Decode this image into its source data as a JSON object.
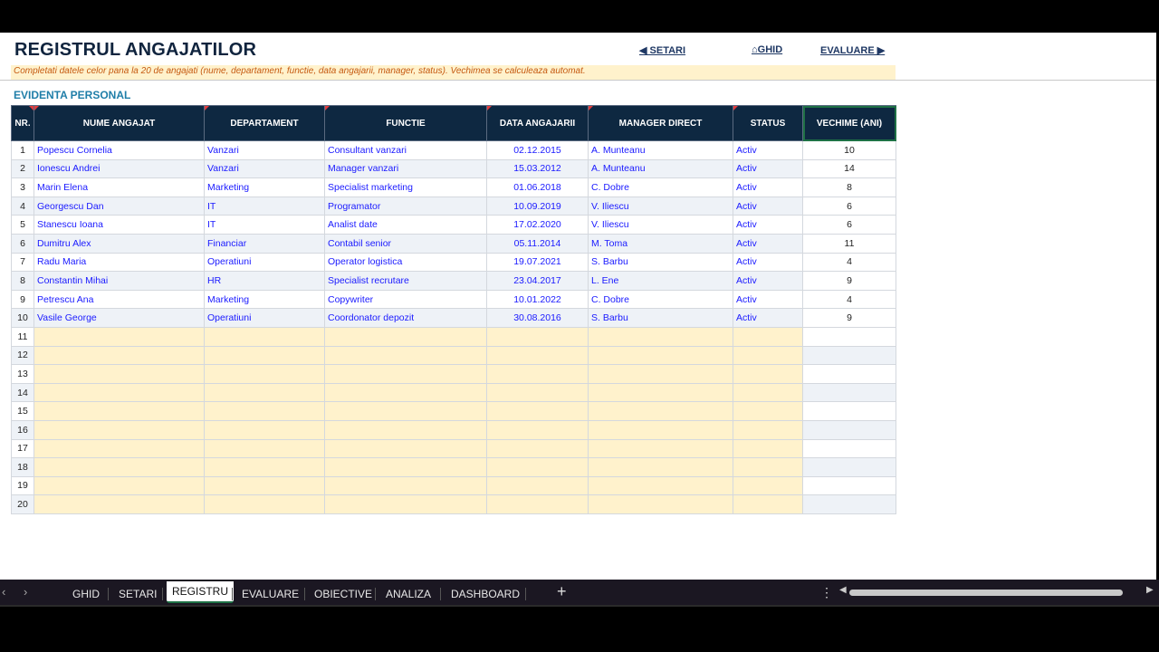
{
  "title": "REGISTRUL ANGAJATILOR",
  "nav": {
    "setari": "◀ SETARI",
    "ghid": "⌂GHID",
    "evaluare": "EVALUARE ▶"
  },
  "subtitle": "Completati datele celor pana la 20 de angajati (nume, departament, functie, data angajarii, manager, status). Vechimea se calculeaza automat.",
  "section_title": "EVIDENTA PERSONAL",
  "columns": [
    "NR.",
    "NUME ANGAJAT",
    "DEPARTAMENT",
    "FUNCTIE",
    "DATA ANGAJARII",
    "MANAGER DIRECT",
    "STATUS",
    "VECHIME (ANI)"
  ],
  "rows": [
    {
      "nr": "1",
      "nume": "Popescu Cornelia",
      "dep": "Vanzari",
      "functie": "Consultant vanzari",
      "data": "02.12.2015",
      "manager": "A. Munteanu",
      "status": "Activ",
      "vechime": "10"
    },
    {
      "nr": "2",
      "nume": "Ionescu Andrei",
      "dep": "Vanzari",
      "functie": "Manager vanzari",
      "data": "15.03.2012",
      "manager": "A. Munteanu",
      "status": "Activ",
      "vechime": "14"
    },
    {
      "nr": "3",
      "nume": "Marin Elena",
      "dep": "Marketing",
      "functie": "Specialist marketing",
      "data": "01.06.2018",
      "manager": "C. Dobre",
      "status": "Activ",
      "vechime": "8"
    },
    {
      "nr": "4",
      "nume": "Georgescu Dan",
      "dep": "IT",
      "functie": "Programator",
      "data": "10.09.2019",
      "manager": "V. Iliescu",
      "status": "Activ",
      "vechime": "6"
    },
    {
      "nr": "5",
      "nume": "Stanescu Ioana",
      "dep": "IT",
      "functie": "Analist date",
      "data": "17.02.2020",
      "manager": "V. Iliescu",
      "status": "Activ",
      "vechime": "6"
    },
    {
      "nr": "6",
      "nume": "Dumitru Alex",
      "dep": "Financiar",
      "functie": "Contabil senior",
      "data": "05.11.2014",
      "manager": "M. Toma",
      "status": "Activ",
      "vechime": "11"
    },
    {
      "nr": "7",
      "nume": "Radu Maria",
      "dep": "Operatiuni",
      "functie": "Operator logistica",
      "data": "19.07.2021",
      "manager": "S. Barbu",
      "status": "Activ",
      "vechime": "4"
    },
    {
      "nr": "8",
      "nume": "Constantin Mihai",
      "dep": "HR",
      "functie": "Specialist recrutare",
      "data": "23.04.2017",
      "manager": "L. Ene",
      "status": "Activ",
      "vechime": "9"
    },
    {
      "nr": "9",
      "nume": "Petrescu Ana",
      "dep": "Marketing",
      "functie": "Copywriter",
      "data": "10.01.2022",
      "manager": "C. Dobre",
      "status": "Activ",
      "vechime": "4"
    },
    {
      "nr": "10",
      "nume": "Vasile George",
      "dep": "Operatiuni",
      "functie": "Coordonator depozit",
      "data": "30.08.2016",
      "manager": "S. Barbu",
      "status": "Activ",
      "vechime": "9"
    },
    {
      "nr": "11",
      "nume": "",
      "dep": "",
      "functie": "",
      "data": "",
      "manager": "",
      "status": "",
      "vechime": ""
    },
    {
      "nr": "12",
      "nume": "",
      "dep": "",
      "functie": "",
      "data": "",
      "manager": "",
      "status": "",
      "vechime": ""
    },
    {
      "nr": "13",
      "nume": "",
      "dep": "",
      "functie": "",
      "data": "",
      "manager": "",
      "status": "",
      "vechime": ""
    },
    {
      "nr": "14",
      "nume": "",
      "dep": "",
      "functie": "",
      "data": "",
      "manager": "",
      "status": "",
      "vechime": ""
    },
    {
      "nr": "15",
      "nume": "",
      "dep": "",
      "functie": "",
      "data": "",
      "manager": "",
      "status": "",
      "vechime": ""
    },
    {
      "nr": "16",
      "nume": "",
      "dep": "",
      "functie": "",
      "data": "",
      "manager": "",
      "status": "",
      "vechime": ""
    },
    {
      "nr": "17",
      "nume": "",
      "dep": "",
      "functie": "",
      "data": "",
      "manager": "",
      "status": "",
      "vechime": ""
    },
    {
      "nr": "18",
      "nume": "",
      "dep": "",
      "functie": "",
      "data": "",
      "manager": "",
      "status": "",
      "vechime": ""
    },
    {
      "nr": "19",
      "nume": "",
      "dep": "",
      "functie": "",
      "data": "",
      "manager": "",
      "status": "",
      "vechime": ""
    },
    {
      "nr": "20",
      "nume": "",
      "dep": "",
      "functie": "",
      "data": "",
      "manager": "",
      "status": "",
      "vechime": ""
    }
  ],
  "tabs": [
    "GHID",
    "SETARI",
    "REGISTRU",
    "EVALUARE",
    "OBIECTIVE",
    "ANALIZA",
    "DASHBOARD"
  ],
  "active_tab": "REGISTRU",
  "tab_add": "+",
  "colors": {
    "header_bg": "#0e2841",
    "input_bg": "#fff2cc",
    "input_text": "#1a1aff",
    "title": "#10243e",
    "section": "#1f7ea8",
    "subtitle": "#c55a11"
  }
}
